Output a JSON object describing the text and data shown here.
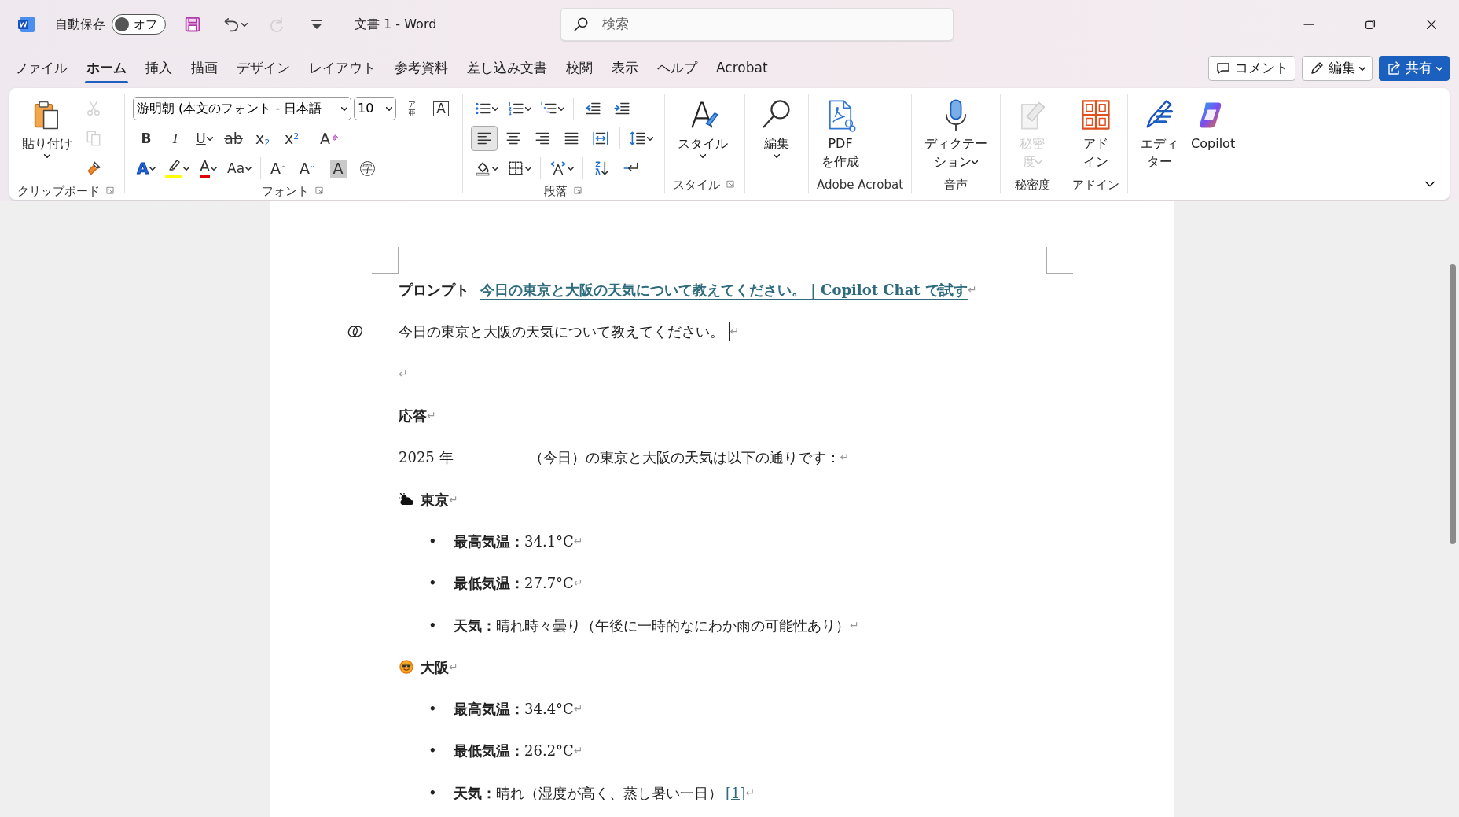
{
  "title_bar": {
    "autosave_label": "自動保存",
    "autosave_toggle": {
      "label": "オフ",
      "on": false
    },
    "quick_access": [
      {
        "kind": "save",
        "disabled": false
      },
      {
        "kind": "undo",
        "disabled": false,
        "dropdown": true
      },
      {
        "kind": "redo",
        "disabled": true
      },
      {
        "kind": "customize",
        "disabled": false
      }
    ],
    "title": "文書 1 - Word",
    "search": {
      "placeholder": "検索"
    }
  },
  "menu_tabs": [
    {
      "label": "ファイル",
      "selected": false
    },
    {
      "label": "ホーム",
      "selected": true
    },
    {
      "label": "挿入",
      "selected": false
    },
    {
      "label": "描画",
      "selected": false
    },
    {
      "label": "デザイン",
      "selected": false
    },
    {
      "label": "レイアウト",
      "selected": false
    },
    {
      "label": "参考資料",
      "selected": false
    },
    {
      "label": "差し込み文書",
      "selected": false
    },
    {
      "label": "校閲",
      "selected": false
    },
    {
      "label": "表示",
      "selected": false
    },
    {
      "label": "ヘルプ",
      "selected": false
    },
    {
      "label": "Acrobat",
      "selected": false
    }
  ],
  "actions": [
    {
      "kind": "comment",
      "label": "コメント"
    },
    {
      "kind": "edit",
      "label": "編集",
      "dropdown": true
    },
    {
      "kind": "share",
      "label": "共有",
      "dropdown": true
    }
  ],
  "ribbon": {
    "groups": [
      {
        "label": "クリップボード",
        "launcher": true,
        "large": [
          {
            "kind": "paste",
            "label_lines": [
              "貼り付け"
            ],
            "dropdown": true,
            "disabled": false
          }
        ],
        "rows": [
          {
            "items": [
              {
                "kind": "cut",
                "disabled": true
              }
            ]
          },
          {
            "items": [
              {
                "kind": "copy",
                "disabled": true
              }
            ]
          },
          {
            "items": [
              {
                "kind": "brush",
                "disabled": false
              }
            ]
          }
        ]
      },
      {
        "label": "フォント",
        "launcher": true,
        "rows": [
          {
            "items": [
              {
                "kind": "font-field",
                "value": "游明朝 (本文のフォント - 日本語"
              },
              {
                "kind": "size-field",
                "value": "10"
              },
              {
                "kind": "ruby",
                "text": "ア",
                "base": "亜"
              },
              {
                "kind": "enclosed",
                "text": "A"
              }
            ]
          },
          {
            "items": [
              {
                "kind": "bold",
                "text": "B"
              },
              {
                "kind": "italic",
                "text": "I"
              },
              {
                "kind": "underline",
                "text": "U",
                "dropdown": true
              },
              {
                "kind": "strike",
                "text": "ab"
              },
              {
                "kind": "subscript",
                "text": "x$_{2}$"
              },
              {
                "kind": "superscript",
                "text": "x$^{2}$"
              },
              {
                "kind": "sep"
              },
              {
                "kind": "clear",
                "text": "A"
              }
            ]
          },
          {
            "items": [
              {
                "kind": "effect",
                "text": "A",
                "dropdown": true
              },
              {
                "kind": "highlight",
                "color": "#ffff00",
                "dropdown": true
              },
              {
                "kind": "color",
                "text": "A",
                "color": "#e00000",
                "dropdown": true
              },
              {
                "kind": "case",
                "text": "Aa",
                "dropdown": true
              },
              {
                "kind": "sep"
              },
              {
                "kind": "grow",
                "text": "A"
              },
              {
                "kind": "shrink",
                "text": "A"
              },
              {
                "kind": "shade",
                "text": "A"
              },
              {
                "kind": "circle",
                "text": "字"
              }
            ]
          }
        ]
      },
      {
        "label": "段落",
        "launcher": true,
        "rows": [
          {
            "items": [
              {
                "kind": "bullets",
                "dropdown": true
              },
              {
                "kind": "numbering",
                "dropdown": true
              },
              {
                "kind": "multilevel",
                "dropdown": true
              },
              {
                "kind": "sep"
              },
              {
                "kind": "outdent"
              },
              {
                "kind": "indent"
              }
            ]
          },
          {
            "items": [
              {
                "kind": "align-left",
                "selected": true
              },
              {
                "kind": "align-center",
                "selected": false
              },
              {
                "kind": "align-right",
                "selected": false
              },
              {
                "kind": "justify",
                "selected": false
              },
              {
                "kind": "distribute",
                "selected": false
              },
              {
                "kind": "sep"
              },
              {
                "kind": "spacing",
                "dropdown": true
              }
            ]
          },
          {
            "items": [
              {
                "kind": "shading",
                "dropdown": true
              },
              {
                "kind": "borders",
                "dropdown": true
              },
              {
                "kind": "sep"
              },
              {
                "kind": "direction",
                "dropdown": true
              },
              {
                "kind": "sep"
              },
              {
                "kind": "sort"
              },
              {
                "kind": "marks"
              }
            ]
          }
        ]
      },
      {
        "label": "スタイル",
        "launcher": true,
        "large": [
          {
            "kind": "styles",
            "label_lines": [
              "スタイル"
            ],
            "dropdown": true,
            "disabled": false
          }
        ]
      },
      {
        "large": [
          {
            "kind": "find",
            "label_lines": [
              "編集"
            ],
            "dropdown": true,
            "disabled": false
          }
        ]
      },
      {
        "label": "Adobe Acrobat",
        "large": [
          {
            "kind": "pdf",
            "label_lines": [
              "PDF",
              "を作成"
            ],
            "disabled": false
          }
        ]
      },
      {
        "label": "音声",
        "large": [
          {
            "kind": "mic",
            "label_lines": [
              "ディクテー",
              "ション"
            ],
            "dropdown": true,
            "disabled": false
          }
        ]
      },
      {
        "label": "秘密度",
        "large": [
          {
            "kind": "sensitivity",
            "label_lines": [
              "秘密",
              "度"
            ],
            "dropdown": true,
            "disabled": true
          }
        ]
      },
      {
        "label": "アドイン",
        "large": [
          {
            "kind": "addins",
            "label_lines": [
              "アド",
              "イン"
            ],
            "disabled": false
          }
        ]
      },
      {
        "large": [
          {
            "kind": "editor",
            "label_lines": [
              "エディ",
              "ター"
            ],
            "disabled": false
          },
          {
            "kind": "copilot",
            "label_lines": [
              "Copilot"
            ],
            "disabled": false
          }
        ]
      }
    ]
  },
  "document": {
    "paragraphs": [
      {
        "kind": "prompt",
        "label": "プロンプト",
        "link": "今日の東京と大阪の天気について教えてください。 | Copilot Chat で試す",
        "mark": "↵"
      },
      {
        "kind": "query",
        "text": "今日の東京と大阪の天気について教えてください。",
        "cursor": true,
        "mark": "↵"
      },
      {
        "kind": "empty",
        "mark": "↵"
      },
      {
        "kind": "heading",
        "text": "応答",
        "mark": "↵"
      },
      {
        "kind": "date",
        "parts": [
          "2025 年",
          "（今日）の東京と大阪の天気は以下の通りです："
        ],
        "mark": "↵"
      },
      {
        "kind": "cloud-heading",
        "text": "東京",
        "mark": "↵"
      },
      {
        "kind": "bullet",
        "bullet": "•",
        "label": "最高気温：",
        "text": "34.1°C",
        "mark": "↵"
      },
      {
        "kind": "bullet",
        "bullet": "•",
        "label": "最低気温：",
        "text": "27.7°C",
        "mark": "↵"
      },
      {
        "kind": "bullet",
        "bullet": "•",
        "label": "天気：",
        "text": "晴れ時々曇り（午後に一時的なにわか雨の可能性あり）",
        "mark": "↵"
      },
      {
        "kind": "sun-heading",
        "text": "大阪",
        "mark": "↵"
      },
      {
        "kind": "bullet",
        "bullet": "•",
        "label": "最高気温：",
        "text": "34.4°C",
        "mark": "↵"
      },
      {
        "kind": "bullet",
        "bullet": "•",
        "label": "最低気温：",
        "text": "26.2°C",
        "mark": "↵"
      },
      {
        "kind": "bullet",
        "bullet": "•",
        "label": "天気：",
        "text": "晴れ（湿度が高く、蒸し暑い一日）",
        "ref": "[1]",
        "mark": "↵"
      }
    ]
  }
}
